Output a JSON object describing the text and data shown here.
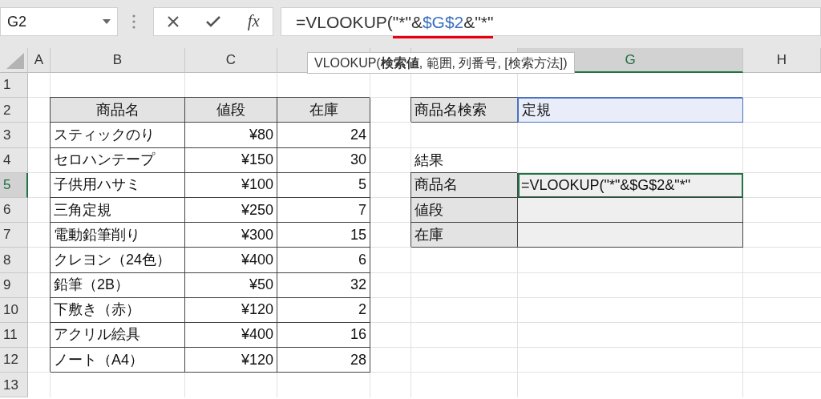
{
  "name_box": {
    "value": "G2"
  },
  "formula_bar": {
    "fx_label": "fx",
    "segments": [
      {
        "text": "=VLOOKUP(",
        "kind": "plain",
        "underlined": false
      },
      {
        "text": "\"*\"&",
        "kind": "plain",
        "underlined": true
      },
      {
        "text": "$G$2",
        "kind": "reference",
        "underlined": true
      },
      {
        "text": "&\"*\"",
        "kind": "plain",
        "underlined": true
      }
    ]
  },
  "tooltip": {
    "text": "VLOOKUP(**検索値**, 範囲, 列番号, [検索方法])"
  },
  "columns": [
    {
      "label": "A",
      "selected": false
    },
    {
      "label": "B",
      "selected": false
    },
    {
      "label": "C",
      "selected": false
    },
    {
      "selected": false
    },
    {
      "selected": false
    },
    {
      "selected": false
    },
    {
      "label": "G",
      "selected": true
    },
    {
      "label": "H",
      "selected": false
    }
  ],
  "rows": [
    {
      "number": "1",
      "selected": false,
      "cells": []
    },
    {
      "number": "2",
      "selected": false,
      "cells": [
        null,
        {
          "text": "商品名",
          "kind": "header"
        },
        {
          "text": "値段",
          "kind": "header"
        },
        {
          "text": "在庫",
          "kind": "header"
        },
        null,
        {
          "text": "商品名検索",
          "kind": "label"
        },
        {
          "text": "定規",
          "kind": "reference"
        }
      ]
    },
    {
      "number": "3",
      "selected": false,
      "cells": [
        null,
        {
          "text": "スティックのり",
          "kind": "text"
        },
        {
          "text": "¥80",
          "kind": "number"
        },
        {
          "text": "24",
          "kind": "number"
        }
      ]
    },
    {
      "number": "4",
      "selected": false,
      "cells": [
        null,
        {
          "text": "セロハンテープ",
          "kind": "text"
        },
        {
          "text": "¥150",
          "kind": "number"
        },
        {
          "text": "30",
          "kind": "number"
        },
        null,
        {
          "text": "結果",
          "kind": "plain"
        }
      ]
    },
    {
      "number": "5",
      "selected": true,
      "cells": [
        null,
        {
          "text": "子供用ハサミ",
          "kind": "text"
        },
        {
          "text": "¥100",
          "kind": "number"
        },
        {
          "text": "5",
          "kind": "number"
        },
        null,
        {
          "text": "商品名",
          "kind": "label"
        },
        {
          "text": "=VLOOKUP(\"*\"&$G$2&\"*\"",
          "kind": "editing"
        }
      ]
    },
    {
      "number": "6",
      "selected": false,
      "cells": [
        null,
        {
          "text": "三角定規",
          "kind": "text"
        },
        {
          "text": "¥250",
          "kind": "number"
        },
        {
          "text": "7",
          "kind": "number"
        },
        null,
        {
          "text": "値段",
          "kind": "label"
        },
        {
          "kind": "blank"
        }
      ]
    },
    {
      "number": "7",
      "selected": false,
      "cells": [
        null,
        {
          "text": "電動鉛筆削り",
          "kind": "text"
        },
        {
          "text": "¥300",
          "kind": "number"
        },
        {
          "text": "15",
          "kind": "number"
        },
        null,
        {
          "text": "在庫",
          "kind": "label"
        },
        {
          "kind": "blank"
        }
      ]
    },
    {
      "number": "8",
      "selected": false,
      "cells": [
        null,
        {
          "text": "クレヨン（24色）",
          "kind": "text"
        },
        {
          "text": "¥400",
          "kind": "number"
        },
        {
          "text": "6",
          "kind": "number"
        }
      ]
    },
    {
      "number": "9",
      "selected": false,
      "cells": [
        null,
        {
          "text": "鉛筆（2B）",
          "kind": "text"
        },
        {
          "text": "¥50",
          "kind": "number"
        },
        {
          "text": "32",
          "kind": "number"
        }
      ]
    },
    {
      "number": "10",
      "selected": false,
      "cells": [
        null,
        {
          "text": "下敷き（赤）",
          "kind": "text"
        },
        {
          "text": "¥120",
          "kind": "number"
        },
        {
          "text": "2",
          "kind": "number"
        }
      ]
    },
    {
      "number": "11",
      "selected": false,
      "cells": [
        null,
        {
          "text": "アクリル絵具",
          "kind": "text"
        },
        {
          "text": "¥400",
          "kind": "number"
        },
        {
          "text": "16",
          "kind": "number"
        }
      ]
    },
    {
      "number": "12",
      "selected": false,
      "cells": [
        null,
        {
          "text": "ノート（A4）",
          "kind": "text"
        },
        {
          "text": "¥120",
          "kind": "number"
        },
        {
          "text": "28",
          "kind": "number"
        }
      ]
    },
    {
      "number": "13",
      "selected": false,
      "cells": []
    }
  ]
}
